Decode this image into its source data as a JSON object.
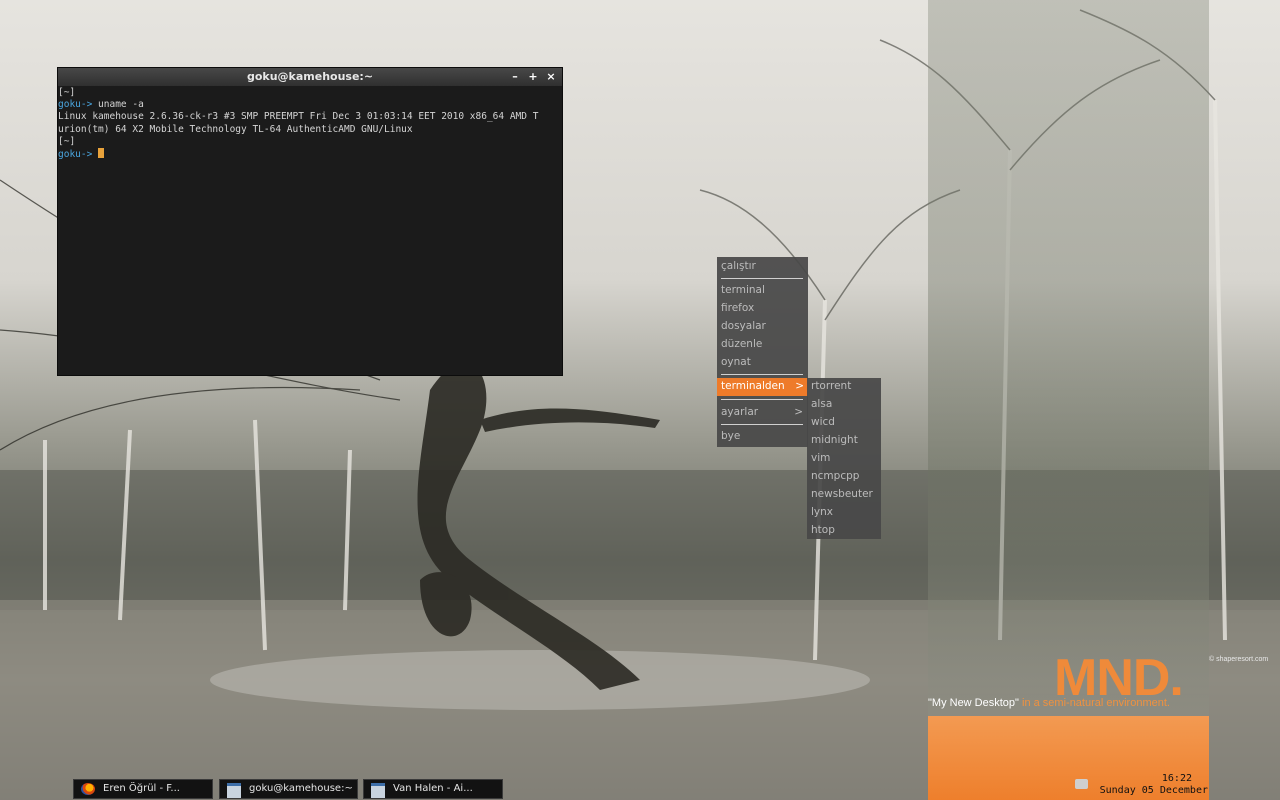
{
  "terminal": {
    "title": "goku@kamehouse:~",
    "controls": {
      "minimize": "–",
      "maximize": "+",
      "close": "×"
    },
    "lines": [
      {
        "prompt": "",
        "text": "[~]"
      },
      {
        "prompt": "goku->",
        "text": " uname -a"
      },
      {
        "prompt": "",
        "text": "Linux kamehouse 2.6.36-ck-r3 #3 SMP PREEMPT Fri Dec 3 01:03:14 EET 2010 x86_64 AMD T"
      },
      {
        "prompt": "",
        "text": "urion(tm) 64 X2 Mobile Technology TL-64 AuthenticAMD GNU/Linux"
      },
      {
        "prompt": "",
        "text": "[~]"
      },
      {
        "prompt": "goku->",
        "text": " "
      }
    ]
  },
  "menu": {
    "header": "çalıştır",
    "items": [
      "terminal",
      "firefox",
      "dosyalar",
      "düzenle",
      "oynat"
    ],
    "active": "terminalden",
    "settings": "ayarlar",
    "exit": "bye",
    "arrow": ">"
  },
  "submenu": {
    "items": [
      "rtorrent",
      "alsa",
      "wicd",
      "midnight",
      "vim",
      "ncmpcpp",
      "newsbeuter",
      "lynx",
      "htop"
    ]
  },
  "taskbar": [
    {
      "label": "Eren Öğrül - F...",
      "icon": "firefox-icon"
    },
    {
      "label": "goku@kamehouse:~",
      "icon": "window-icon"
    },
    {
      "label": "Van Halen - Ai...",
      "icon": "window-icon"
    }
  ],
  "wallpaper": {
    "logo": "MND.",
    "tagline_quote": "\"My New Desktop\"",
    "tagline_rest": " in a semi-natural environment.",
    "credit": "© shaperesort.com"
  },
  "clock": {
    "time": "16:22",
    "date": "Sunday 05 December"
  },
  "colors": {
    "accent": "#ee7b2a",
    "prompt": "#4aa6e0",
    "cursor": "#e8a23b"
  }
}
